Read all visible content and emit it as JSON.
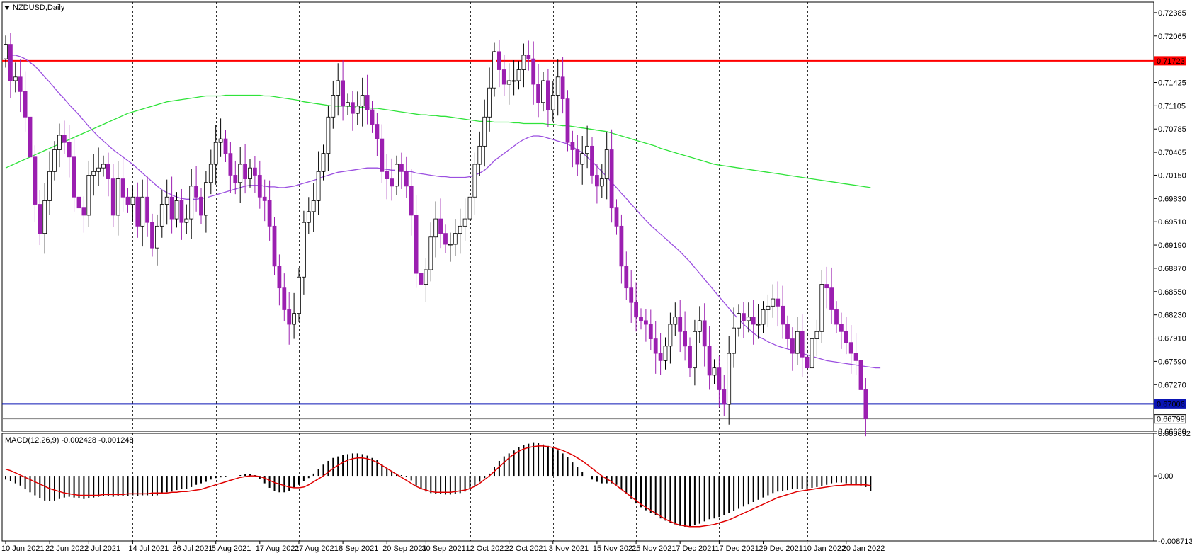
{
  "window": {
    "title": "NZDUSD,Daily",
    "macd_label": "MACD(12,26,9) -0.002428 -0.001248"
  },
  "colors": {
    "bull": "#ffffff",
    "bear": "#9b1fb0",
    "wick_bear": "#9b1fb0",
    "wick_bull": "#000000",
    "ma_purple": "#9b4fe0",
    "ma_green": "#2fe33a",
    "resistance": "#ff0000",
    "support": "#0a14b4",
    "macd_signal": "#e00000",
    "histogram": "#000000"
  },
  "chart_data": [
    {
      "type": "candlestick",
      "title": "NZDUSD,Daily",
      "ylim": [
        0.6663,
        0.7253
      ],
      "y_ticks": [
        "0.72385",
        "0.72065",
        "0.71723",
        "0.71425",
        "0.71105",
        "0.70785",
        "0.70465",
        "0.70150",
        "0.69830",
        "0.69510",
        "0.69190",
        "0.68870",
        "0.68550",
        "0.68230",
        "0.67910",
        "0.67590",
        "0.67270",
        "0.67006",
        "0.66799",
        "0.66630"
      ],
      "x_labels": [
        "10 Jun 2021",
        "22 Jun 2021",
        "2 Jul 2021",
        "14 Jul 2021",
        "26 Jul 2021",
        "5 Aug 2021",
        "17 Aug 2021",
        "27 Aug 2021",
        "8 Sep 2021",
        "20 Sep 2021",
        "30 Sep 2021",
        "12 Oct 2021",
        "22 Oct 2021",
        "3 Nov 2021",
        "15 Nov 2021",
        "25 Nov 2021",
        "7 Dec 2021",
        "17 Dec 2021",
        "29 Dec 2021",
        "10 Jan 2022",
        "20 Jan 2022"
      ],
      "horizontal_lines": [
        {
          "price": 0.71723,
          "label": "0.71723",
          "color": "#ff0000"
        },
        {
          "price": 0.67006,
          "label": "0.67006",
          "color": "#0a14b4"
        },
        {
          "price": 0.66799,
          "label": "0.66799",
          "color": "#808080"
        }
      ],
      "closes": [
        0.7195,
        0.7145,
        0.715,
        0.713,
        0.7095,
        0.704,
        0.6975,
        0.6935,
        0.698,
        0.702,
        0.705,
        0.707,
        0.706,
        0.704,
        0.6985,
        0.697,
        0.696,
        0.7015,
        0.702,
        0.7025,
        0.703,
        0.701,
        0.696,
        0.701,
        0.6985,
        0.6975,
        0.6985,
        0.6945,
        0.6985,
        0.695,
        0.6915,
        0.6945,
        0.6975,
        0.6985,
        0.6955,
        0.698,
        0.695,
        0.6955,
        0.7,
        0.6985,
        0.696,
        0.7005,
        0.703,
        0.706,
        0.7065,
        0.7045,
        0.7015,
        0.7005,
        0.703,
        0.701,
        0.7025,
        0.7015,
        0.6985,
        0.698,
        0.6945,
        0.689,
        0.686,
        0.683,
        0.681,
        0.6825,
        0.6875,
        0.695,
        0.6965,
        0.698,
        0.702,
        0.7045,
        0.7095,
        0.7125,
        0.7145,
        0.711,
        0.7115,
        0.71,
        0.711,
        0.7125,
        0.7105,
        0.7085,
        0.7065,
        0.702,
        0.701,
        0.7,
        0.703,
        0.702,
        0.7,
        0.696,
        0.688,
        0.6865,
        0.6885,
        0.693,
        0.6955,
        0.6935,
        0.692,
        0.692,
        0.6935,
        0.6945,
        0.6955,
        0.6985,
        0.703,
        0.7055,
        0.7095,
        0.7135,
        0.7185,
        0.716,
        0.714,
        0.7145,
        0.7145,
        0.716,
        0.718,
        0.7175,
        0.714,
        0.7115,
        0.7145,
        0.7105,
        0.7125,
        0.715,
        0.712,
        0.706,
        0.705,
        0.703,
        0.7045,
        0.7055,
        0.7015,
        0.7,
        0.701,
        0.705,
        0.697,
        0.6945,
        0.689,
        0.686,
        0.684,
        0.682,
        0.6815,
        0.681,
        0.679,
        0.677,
        0.676,
        0.678,
        0.681,
        0.682,
        0.68,
        0.678,
        0.675,
        0.68,
        0.6815,
        0.678,
        0.674,
        0.675,
        0.672,
        0.67,
        0.677,
        0.6805,
        0.6825,
        0.6815,
        0.682,
        0.681,
        0.681,
        0.683,
        0.6835,
        0.6845,
        0.6835,
        0.681,
        0.679,
        0.677,
        0.68,
        0.6765,
        0.675,
        0.679,
        0.68,
        0.6865,
        0.686,
        0.683,
        0.681,
        0.68,
        0.6785,
        0.677,
        0.676,
        0.672,
        0.668
      ],
      "opens": [
        0.7175,
        0.7195,
        0.7145,
        0.715,
        0.713,
        0.7095,
        0.704,
        0.6975,
        0.6935,
        0.698,
        0.702,
        0.705,
        0.707,
        0.706,
        0.704,
        0.6985,
        0.697,
        0.696,
        0.7015,
        0.702,
        0.7025,
        0.703,
        0.701,
        0.696,
        0.701,
        0.6985,
        0.6975,
        0.6985,
        0.6945,
        0.6985,
        0.695,
        0.6915,
        0.6945,
        0.6975,
        0.6985,
        0.6955,
        0.698,
        0.695,
        0.6955,
        0.7,
        0.6985,
        0.696,
        0.7005,
        0.703,
        0.706,
        0.7065,
        0.7045,
        0.7015,
        0.7005,
        0.703,
        0.701,
        0.7025,
        0.7015,
        0.6985,
        0.698,
        0.6945,
        0.689,
        0.686,
        0.683,
        0.681,
        0.6825,
        0.6875,
        0.695,
        0.6965,
        0.698,
        0.702,
        0.7045,
        0.7095,
        0.7125,
        0.7145,
        0.711,
        0.7115,
        0.71,
        0.711,
        0.7125,
        0.7105,
        0.7085,
        0.7065,
        0.702,
        0.701,
        0.7,
        0.703,
        0.702,
        0.7,
        0.696,
        0.688,
        0.6865,
        0.6885,
        0.693,
        0.6955,
        0.6935,
        0.692,
        0.692,
        0.6935,
        0.6945,
        0.6955,
        0.6985,
        0.703,
        0.7055,
        0.7095,
        0.7135,
        0.7185,
        0.716,
        0.714,
        0.7145,
        0.7145,
        0.716,
        0.718,
        0.7175,
        0.714,
        0.7115,
        0.7145,
        0.7105,
        0.7125,
        0.715,
        0.712,
        0.706,
        0.705,
        0.703,
        0.7045,
        0.7055,
        0.7015,
        0.7,
        0.701,
        0.705,
        0.697,
        0.6945,
        0.689,
        0.686,
        0.684,
        0.682,
        0.6815,
        0.681,
        0.679,
        0.677,
        0.676,
        0.678,
        0.681,
        0.682,
        0.68,
        0.678,
        0.675,
        0.68,
        0.6815,
        0.678,
        0.674,
        0.675,
        0.672,
        0.67,
        0.677,
        0.6805,
        0.6825,
        0.6815,
        0.682,
        0.681,
        0.681,
        0.683,
        0.6835,
        0.6845,
        0.6835,
        0.681,
        0.679,
        0.677,
        0.68,
        0.6765,
        0.675,
        0.679,
        0.68,
        0.6865,
        0.686,
        0.683,
        0.681,
        0.68,
        0.6785,
        0.677,
        0.676,
        0.672
      ],
      "ma_purple": [
        0.7178,
        0.718,
        0.718,
        0.7178,
        0.7175,
        0.717,
        0.7165,
        0.7158,
        0.715,
        0.7143,
        0.7135,
        0.7127,
        0.712,
        0.7112,
        0.7105,
        0.7098,
        0.709,
        0.7082,
        0.7075,
        0.7068,
        0.7062,
        0.7056,
        0.705,
        0.7045,
        0.704,
        0.7035,
        0.703,
        0.7024,
        0.7018,
        0.7012,
        0.7006,
        0.7,
        0.6995,
        0.6991,
        0.6988,
        0.6985,
        0.6983,
        0.6982,
        0.6982,
        0.6982,
        0.6983,
        0.6984,
        0.6986,
        0.6988,
        0.699,
        0.6992,
        0.6994,
        0.6996,
        0.6998,
        0.7,
        0.7001,
        0.7001,
        0.7001,
        0.7,
        0.6999,
        0.6999,
        0.6998,
        0.6998,
        0.6999,
        0.7,
        0.7002,
        0.7004,
        0.7006,
        0.7008,
        0.701,
        0.7013,
        0.7015,
        0.7017,
        0.7019,
        0.702,
        0.7021,
        0.7022,
        0.7023,
        0.7024,
        0.7025,
        0.7025,
        0.7025,
        0.7024,
        0.7023,
        0.7022,
        0.7022,
        0.7021,
        0.702,
        0.702,
        0.7018,
        0.7017,
        0.7016,
        0.7015,
        0.7014,
        0.7013,
        0.7013,
        0.7012,
        0.7012,
        0.7012,
        0.7012,
        0.7013,
        0.7015,
        0.7018,
        0.7022,
        0.7028,
        0.7035,
        0.704,
        0.7045,
        0.705,
        0.7055,
        0.706,
        0.7064,
        0.7067,
        0.7069,
        0.7069,
        0.7068,
        0.7066,
        0.7064,
        0.7062,
        0.706,
        0.7058,
        0.7054,
        0.705,
        0.7046,
        0.704,
        0.7034,
        0.7027,
        0.702,
        0.7013,
        0.7005,
        0.6998,
        0.699,
        0.6983,
        0.6975,
        0.6968,
        0.696,
        0.6953,
        0.6946,
        0.694,
        0.6934,
        0.6928,
        0.6922,
        0.6916,
        0.691,
        0.6903,
        0.6896,
        0.6888,
        0.688,
        0.6872,
        0.6864,
        0.6856,
        0.6848,
        0.684,
        0.6832,
        0.6824,
        0.6817,
        0.681,
        0.6804,
        0.6798,
        0.6793,
        0.679,
        0.6786,
        0.6783,
        0.678,
        0.6778,
        0.6776,
        0.6774,
        0.6772,
        0.677,
        0.6768,
        0.6766,
        0.6764,
        0.6762,
        0.676,
        0.6759,
        0.6758,
        0.6757,
        0.6756,
        0.6755,
        0.6754,
        0.6753,
        0.6752,
        0.6751,
        0.675,
        0.675
      ],
      "ma_green": [
        0.7025,
        0.7028,
        0.7031,
        0.7034,
        0.7037,
        0.704,
        0.7043,
        0.7046,
        0.7049,
        0.7052,
        0.7055,
        0.7058,
        0.7061,
        0.7064,
        0.7067,
        0.707,
        0.7073,
        0.7076,
        0.7079,
        0.7082,
        0.7085,
        0.7088,
        0.7091,
        0.7094,
        0.7097,
        0.71,
        0.7102,
        0.7104,
        0.7106,
        0.7108,
        0.711,
        0.7112,
        0.7114,
        0.7116,
        0.7117,
        0.7118,
        0.7119,
        0.712,
        0.7121,
        0.7122,
        0.7123,
        0.7124,
        0.7124,
        0.7124,
        0.7124,
        0.7125,
        0.7125,
        0.7125,
        0.7125,
        0.7125,
        0.7125,
        0.7125,
        0.7125,
        0.7124,
        0.7124,
        0.7123,
        0.7122,
        0.7121,
        0.712,
        0.7119,
        0.7118,
        0.7116,
        0.7115,
        0.7114,
        0.7113,
        0.7112,
        0.7111,
        0.711,
        0.711,
        0.711,
        0.711,
        0.7109,
        0.7109,
        0.7108,
        0.7108,
        0.7107,
        0.7107,
        0.7106,
        0.7105,
        0.7104,
        0.7103,
        0.7102,
        0.7101,
        0.71,
        0.7099,
        0.7098,
        0.7098,
        0.7097,
        0.7097,
        0.7096,
        0.7096,
        0.7095,
        0.7094,
        0.7093,
        0.7092,
        0.7091,
        0.709,
        0.7089,
        0.7089,
        0.7089,
        0.7088,
        0.7088,
        0.7088,
        0.7088,
        0.7087,
        0.7087,
        0.7086,
        0.7086,
        0.7086,
        0.7086,
        0.7086,
        0.7085,
        0.7085,
        0.7084,
        0.7083,
        0.7083,
        0.7082,
        0.7081,
        0.708,
        0.7079,
        0.7078,
        0.7077,
        0.7076,
        0.7075,
        0.7073,
        0.7071,
        0.7069,
        0.7067,
        0.7065,
        0.7063,
        0.7061,
        0.7059,
        0.7057,
        0.7055,
        0.7052,
        0.705,
        0.7048,
        0.7046,
        0.7044,
        0.7042,
        0.704,
        0.7038,
        0.7036,
        0.7034,
        0.7032,
        0.703,
        0.7029,
        0.7028,
        0.7027,
        0.7026,
        0.7025,
        0.7024,
        0.7023,
        0.7022,
        0.7021,
        0.702,
        0.7019,
        0.7018,
        0.7017,
        0.7016,
        0.7015,
        0.7014,
        0.7013,
        0.7012,
        0.7011,
        0.701,
        0.7009,
        0.7008,
        0.7007,
        0.7006,
        0.7005,
        0.7004,
        0.7003,
        0.7002,
        0.7001,
        0.7,
        0.6999,
        0.6998
      ]
    },
    {
      "type": "bar",
      "title": "MACD(12,26,9) -0.002428 -0.001248",
      "ylim": [
        -0.008713,
        0.005692
      ],
      "y_ticks": [
        "0.005692",
        "0.00",
        "-0.008713"
      ],
      "macd_hist": [
        -0.0005,
        -0.0007,
        -0.001,
        -0.0013,
        -0.0018,
        -0.0022,
        -0.0026,
        -0.003,
        -0.0033,
        -0.0034,
        -0.0033,
        -0.0031,
        -0.0029,
        -0.0028,
        -0.0029,
        -0.003,
        -0.0031,
        -0.003,
        -0.0029,
        -0.0028,
        -0.0027,
        -0.0027,
        -0.0028,
        -0.0027,
        -0.0027,
        -0.0027,
        -0.0026,
        -0.0027,
        -0.0026,
        -0.0026,
        -0.0027,
        -0.0026,
        -0.0024,
        -0.0022,
        -0.0021,
        -0.0019,
        -0.0018,
        -0.0017,
        -0.0015,
        -0.0012,
        -0.001,
        -0.0008,
        -0.0005,
        -0.0003,
        -0.0002,
        -0.0001,
        0.0,
        0.0,
        0.0001,
        0.0002,
        0.0002,
        0.0001,
        -0.0004,
        -0.001,
        -0.0016,
        -0.002,
        -0.0022,
        -0.0022,
        -0.002,
        -0.0016,
        -0.0012,
        -0.0007,
        -0.0003,
        0.0003,
        0.0009,
        0.0015,
        0.002,
        0.0024,
        0.0026,
        0.0028,
        0.0029,
        0.003,
        0.003,
        0.0029,
        0.0027,
        0.0024,
        0.0021,
        0.0016,
        0.001,
        0.0005,
        0.0003,
        0.0001,
        -0.0001,
        -0.0006,
        -0.0013,
        -0.0018,
        -0.0021,
        -0.0023,
        -0.0024,
        -0.0024,
        -0.0025,
        -0.0025,
        -0.0024,
        -0.0023,
        -0.0021,
        -0.0018,
        -0.0013,
        -0.0008,
        -0.0003,
        0.0003,
        0.0012,
        0.002,
        0.0026,
        0.003,
        0.0034,
        0.0038,
        0.0041,
        0.0043,
        0.0045,
        0.0044,
        0.0042,
        0.004,
        0.0037,
        0.0034,
        0.003,
        0.0025,
        0.0018,
        0.0012,
        0.0005,
        0.0,
        -0.0005,
        -0.0008,
        -0.001,
        -0.001,
        -0.001,
        -0.0012,
        -0.0017,
        -0.0024,
        -0.0031,
        -0.0037,
        -0.0042,
        -0.0046,
        -0.005,
        -0.0053,
        -0.0057,
        -0.006,
        -0.0063,
        -0.0065,
        -0.0067,
        -0.0068,
        -0.0068,
        -0.0066,
        -0.0064,
        -0.0061,
        -0.0058,
        -0.0057,
        -0.0055,
        -0.0053,
        -0.005,
        -0.0047,
        -0.0044,
        -0.0041,
        -0.0038,
        -0.0035,
        -0.0032,
        -0.0029,
        -0.0026,
        -0.0023,
        -0.0021,
        -0.002,
        -0.0019,
        -0.0018,
        -0.0017,
        -0.0017,
        -0.0017,
        -0.0016,
        -0.0015,
        -0.0014,
        -0.0012,
        -0.001,
        -0.0009,
        -0.0009,
        -0.001,
        -0.0011,
        -0.0012,
        -0.0013,
        -0.0015,
        -0.002
      ],
      "macd_signal": [
        0.0009,
        0.0007,
        0.0004,
        0.0001,
        -0.0002,
        -0.0005,
        -0.0008,
        -0.0011,
        -0.0014,
        -0.0017,
        -0.0019,
        -0.0021,
        -0.0023,
        -0.0024,
        -0.0025,
        -0.0026,
        -0.0026,
        -0.0026,
        -0.0026,
        -0.0026,
        -0.0025,
        -0.0025,
        -0.0025,
        -0.0025,
        -0.0025,
        -0.0024,
        -0.0024,
        -0.0024,
        -0.0024,
        -0.0024,
        -0.0023,
        -0.0023,
        -0.0023,
        -0.0023,
        -0.0022,
        -0.0022,
        -0.0021,
        -0.0021,
        -0.002,
        -0.0019,
        -0.0018,
        -0.0016,
        -0.0014,
        -0.0012,
        -0.001,
        -0.0008,
        -0.0006,
        -0.0004,
        -0.0002,
        -0.0001,
        0.0,
        0.0,
        -0.0001,
        -0.0003,
        -0.0006,
        -0.0009,
        -0.0011,
        -0.0013,
        -0.0015,
        -0.0016,
        -0.0016,
        -0.0015,
        -0.0012,
        -0.0008,
        -0.0004,
        0.0,
        0.0005,
        0.001,
        0.0014,
        0.0018,
        0.0021,
        0.0023,
        0.0024,
        0.0024,
        0.0023,
        0.0021,
        0.0018,
        0.0014,
        0.001,
        0.0006,
        0.0002,
        -0.0002,
        -0.0006,
        -0.001,
        -0.0014,
        -0.0017,
        -0.0019,
        -0.0021,
        -0.0022,
        -0.0022,
        -0.0022,
        -0.0022,
        -0.0021,
        -0.002,
        -0.0019,
        -0.0017,
        -0.0014,
        -0.001,
        -0.0005,
        0.0,
        0.0006,
        0.0012,
        0.0018,
        0.0024,
        0.0029,
        0.0033,
        0.0036,
        0.0038,
        0.0039,
        0.004,
        0.004,
        0.0039,
        0.0038,
        0.0036,
        0.0034,
        0.0031,
        0.0028,
        0.0024,
        0.002,
        0.0015,
        0.001,
        0.0005,
        0.0,
        -0.0004,
        -0.0008,
        -0.0013,
        -0.0018,
        -0.0023,
        -0.0028,
        -0.0033,
        -0.0038,
        -0.0042,
        -0.0046,
        -0.005,
        -0.0054,
        -0.0058,
        -0.0061,
        -0.0064,
        -0.0066,
        -0.0067,
        -0.0068,
        -0.0068,
        -0.0068,
        -0.0067,
        -0.0066,
        -0.0065,
        -0.0063,
        -0.0061,
        -0.0059,
        -0.0056,
        -0.0053,
        -0.005,
        -0.0047,
        -0.0044,
        -0.0041,
        -0.0038,
        -0.0035,
        -0.0032,
        -0.0029,
        -0.0027,
        -0.0025,
        -0.0023,
        -0.0021,
        -0.002,
        -0.0019,
        -0.0018,
        -0.0017,
        -0.0016,
        -0.0015,
        -0.0014,
        -0.0013,
        -0.0013,
        -0.0012,
        -0.0012,
        -0.0012,
        -0.0012,
        -0.0012,
        -0.0013
      ]
    }
  ]
}
